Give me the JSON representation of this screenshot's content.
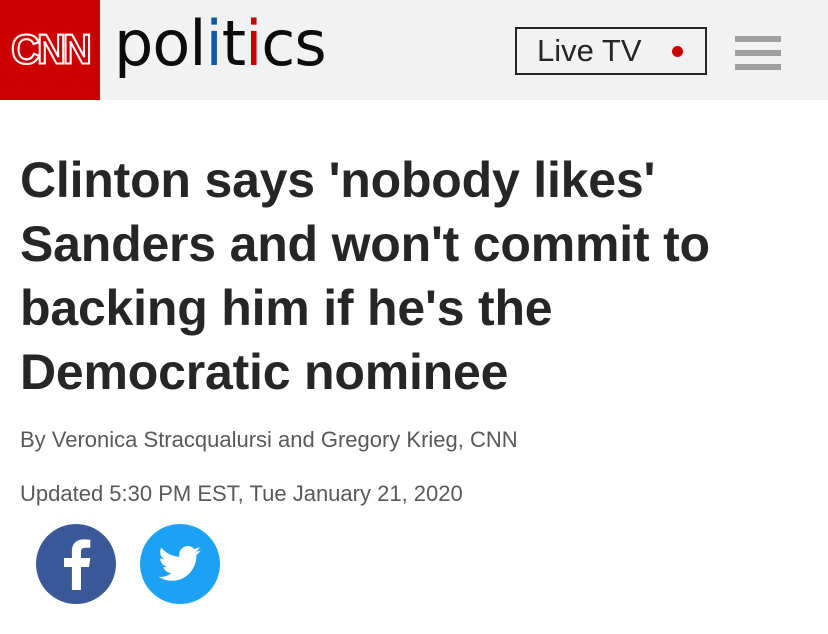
{
  "header": {
    "logo_text": "CNN",
    "section_parts": [
      "pol",
      "i",
      "t",
      "i",
      "cs"
    ],
    "live_tv_label": "Live TV"
  },
  "article": {
    "headline": "Clinton says 'nobody likes' Sanders and won't commit to backing him if he's the Democratic nominee",
    "byline": "By Veronica Stracqualursi and Gregory Krieg, CNN",
    "timestamp": "Updated 5:30 PM EST, Tue January 21, 2020"
  },
  "icons": {
    "menu": "hamburger-menu-icon",
    "facebook": "facebook-icon",
    "twitter": "twitter-bird-icon",
    "live": "live-dot-icon"
  },
  "colors": {
    "brand_red": "#cc0000",
    "politics_blue": "#0c5aa6",
    "facebook_blue": "#3b5998",
    "twitter_blue": "#1da1f2"
  }
}
